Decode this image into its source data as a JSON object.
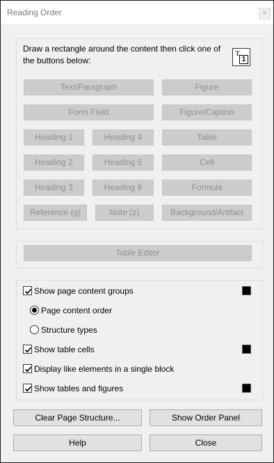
{
  "window": {
    "title": "Reading Order",
    "close_glyph": "×"
  },
  "instruction": "Draw a rectangle around the content then click one of the buttons below:",
  "tag_icon": {
    "name": "tag-order-icon",
    "letter": "T",
    "number": "1"
  },
  "content_buttons": {
    "text_paragraph": "Text/Paragraph",
    "figure": "Figure",
    "form_field": "Form Field",
    "figure_caption": "Figure/Caption",
    "heading1": "Heading 1",
    "heading4": "Heading 4",
    "table": "Table",
    "heading2": "Heading 2",
    "heading5": "Heading 5",
    "cell": "Cell",
    "heading3": "Heading 3",
    "heading6": "Heading 6",
    "formula": "Formula",
    "reference": "Reference (q)",
    "note": "Note (z)",
    "background": "Background/Artifact"
  },
  "table_editor": "Table Editor",
  "options": {
    "show_groups": {
      "label": "Show page content groups",
      "checked": true
    },
    "page_content_order": {
      "label": "Page content order",
      "selected": true
    },
    "structure_types": {
      "label": "Structure types",
      "selected": false
    },
    "show_table_cells": {
      "label": "Show table cells",
      "checked": true
    },
    "display_like": {
      "label": "Display like elements in a single block",
      "checked": true
    },
    "show_tables_figures": {
      "label": "Show tables and figures",
      "checked": true
    }
  },
  "swatch_color": "#000000",
  "bottom_buttons": {
    "clear": "Clear Page Structure...",
    "show_order": "Show Order Panel",
    "help": "Help",
    "close": "Close"
  }
}
